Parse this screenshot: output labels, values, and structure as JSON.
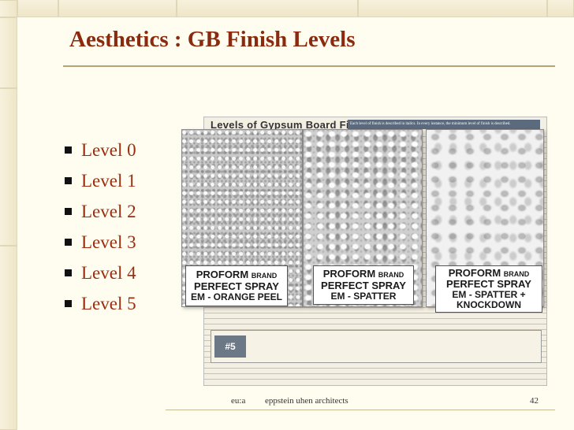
{
  "slide": {
    "title": "Aesthetics : GB Finish Levels",
    "bullets": [
      "Level 0",
      "Level 1",
      "Level 2",
      "Level 3",
      "Level 4",
      "Level 5"
    ],
    "footer_logo": "eu:a",
    "footer_text": "eppstein uhen architects",
    "page_number": "42"
  },
  "document": {
    "heading": "Levels of Gypsum Board Finish",
    "note": "Each level of finish is described in italics. In every instance, the minimum level of finish is described.",
    "row_number": "#5"
  },
  "swatches": [
    {
      "line1a": "PROFORM",
      "line1b": "BRAND",
      "line2": "PERFECT SPRAY",
      "line3": "EM - ORANGE PEEL",
      "line4": ""
    },
    {
      "line1a": "PROFORM",
      "line1b": "BRAND",
      "line2": "PERFECT SPRAY",
      "line3": "EM - SPATTER",
      "line4": ""
    },
    {
      "line1a": "PROFORM",
      "line1b": "BRAND",
      "line2": "PERFECT SPRAY",
      "line3": "EM - SPATTER +",
      "line4": "KNOCKDOWN"
    }
  ],
  "colors": {
    "title": "#8a2a0e",
    "bullet_text": "#9a2d10",
    "background": "#fffdf0"
  }
}
